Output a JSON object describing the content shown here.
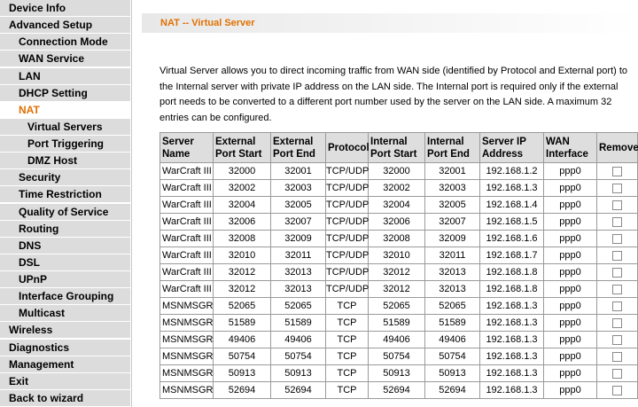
{
  "sidebar": {
    "items": [
      {
        "label": "Device Info",
        "level": 0,
        "active": false
      },
      {
        "label": "Advanced Setup",
        "level": 0,
        "active": false
      },
      {
        "label": "Connection Mode",
        "level": 1,
        "active": false
      },
      {
        "label": "WAN Service",
        "level": 1,
        "active": false
      },
      {
        "label": "LAN",
        "level": 1,
        "active": false
      },
      {
        "label": "DHCP Setting",
        "level": 1,
        "active": false
      },
      {
        "label": "NAT",
        "level": 1,
        "active": true
      },
      {
        "label": "Virtual Servers",
        "level": 2,
        "active": false
      },
      {
        "label": "Port Triggering",
        "level": 2,
        "active": false
      },
      {
        "label": "DMZ Host",
        "level": 2,
        "active": false
      },
      {
        "label": "Security",
        "level": 1,
        "active": false
      },
      {
        "label": "Time Restriction",
        "level": 1,
        "active": false
      },
      {
        "label": "Quality of Service",
        "level": 1,
        "active": false
      },
      {
        "label": "Routing",
        "level": 1,
        "active": false
      },
      {
        "label": "DNS",
        "level": 1,
        "active": false
      },
      {
        "label": "DSL",
        "level": 1,
        "active": false
      },
      {
        "label": "UPnP",
        "level": 1,
        "active": false
      },
      {
        "label": "Interface Grouping",
        "level": 1,
        "active": false
      },
      {
        "label": "Multicast",
        "level": 1,
        "active": false
      },
      {
        "label": "Wireless",
        "level": 0,
        "active": false
      },
      {
        "label": "Diagnostics",
        "level": 0,
        "active": false
      },
      {
        "label": "Management",
        "level": 0,
        "active": false
      },
      {
        "label": "Exit",
        "level": 0,
        "active": false
      },
      {
        "label": "Back to wizard",
        "level": 0,
        "active": false
      }
    ]
  },
  "page": {
    "title": "NAT -- Virtual Server",
    "description": "Virtual Server allows you to direct incoming traffic from WAN side (identified by Protocol and External port) to the Internal server with private IP address on the LAN side. The Internal port is required only if the external port needs to be converted to a different port number used by the server on the LAN side. A maximum 32 entries can be configured."
  },
  "table": {
    "headers": [
      "Server Name",
      "External Port Start",
      "External Port End",
      "Protocol",
      "Internal Port Start",
      "Internal Port End",
      "Server IP Address",
      "WAN Interface",
      "Remove"
    ],
    "rows": [
      [
        "WarCraft III",
        "32000",
        "32001",
        "TCP/UDP",
        "32000",
        "32001",
        "192.168.1.2",
        "ppp0"
      ],
      [
        "WarCraft III",
        "32002",
        "32003",
        "TCP/UDP",
        "32002",
        "32003",
        "192.168.1.3",
        "ppp0"
      ],
      [
        "WarCraft III",
        "32004",
        "32005",
        "TCP/UDP",
        "32004",
        "32005",
        "192.168.1.4",
        "ppp0"
      ],
      [
        "WarCraft III",
        "32006",
        "32007",
        "TCP/UDP",
        "32006",
        "32007",
        "192.168.1.5",
        "ppp0"
      ],
      [
        "WarCraft III",
        "32008",
        "32009",
        "TCP/UDP",
        "32008",
        "32009",
        "192.168.1.6",
        "ppp0"
      ],
      [
        "WarCraft III",
        "32010",
        "32011",
        "TCP/UDP",
        "32010",
        "32011",
        "192.168.1.7",
        "ppp0"
      ],
      [
        "WarCraft III",
        "32012",
        "32013",
        "TCP/UDP",
        "32012",
        "32013",
        "192.168.1.8",
        "ppp0"
      ],
      [
        "WarCraft III",
        "32012",
        "32013",
        "TCP/UDP",
        "32012",
        "32013",
        "192.168.1.8",
        "ppp0"
      ],
      [
        "MSNMSGR",
        "52065",
        "52065",
        "TCP",
        "52065",
        "52065",
        "192.168.1.3",
        "ppp0"
      ],
      [
        "MSNMSGR",
        "51589",
        "51589",
        "TCP",
        "51589",
        "51589",
        "192.168.1.3",
        "ppp0"
      ],
      [
        "MSNMSGR",
        "49406",
        "49406",
        "TCP",
        "49406",
        "49406",
        "192.168.1.3",
        "ppp0"
      ],
      [
        "MSNMSGR",
        "50754",
        "50754",
        "TCP",
        "50754",
        "50754",
        "192.168.1.3",
        "ppp0"
      ],
      [
        "MSNMSGR",
        "50913",
        "50913",
        "TCP",
        "50913",
        "50913",
        "192.168.1.3",
        "ppp0"
      ],
      [
        "MSNMSGR",
        "52694",
        "52694",
        "TCP",
        "52694",
        "52694",
        "192.168.1.3",
        "ppp0"
      ]
    ]
  },
  "colors": {
    "accent": "#e07000",
    "nav_background": "#dcdcdc",
    "header_background": "#dedede"
  }
}
